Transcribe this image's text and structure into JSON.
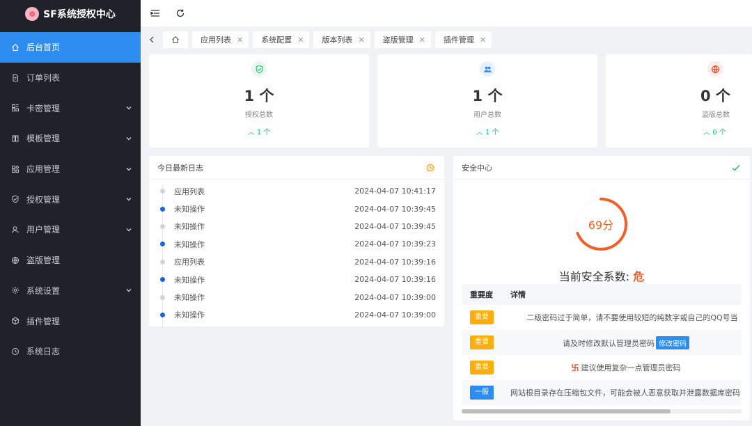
{
  "app": {
    "title": "SF系统授权中心",
    "logo_glyph": "❁"
  },
  "sidebar": {
    "items": [
      {
        "label": "后台首页",
        "icon": "home-icon",
        "active": true,
        "chevron": false
      },
      {
        "label": "订单列表",
        "icon": "document-icon",
        "active": false,
        "chevron": false
      },
      {
        "label": "卡密管理",
        "icon": "grid-icon",
        "active": false,
        "chevron": true
      },
      {
        "label": "模板管理",
        "icon": "book-icon",
        "active": false,
        "chevron": true
      },
      {
        "label": "应用管理",
        "icon": "apps-icon",
        "active": false,
        "chevron": true
      },
      {
        "label": "授权管理",
        "icon": "shield-icon",
        "active": false,
        "chevron": true
      },
      {
        "label": "用户管理",
        "icon": "user-icon",
        "active": false,
        "chevron": true
      },
      {
        "label": "盗版管理",
        "icon": "globe-icon",
        "active": false,
        "chevron": false
      },
      {
        "label": "系统设置",
        "icon": "gear-icon",
        "active": false,
        "chevron": true
      },
      {
        "label": "插件管理",
        "icon": "cube-icon",
        "active": false,
        "chevron": false
      },
      {
        "label": "系统日志",
        "icon": "clock-icon",
        "active": false,
        "chevron": false
      }
    ]
  },
  "tabs": [
    {
      "label": "应用列表"
    },
    {
      "label": "系统配置"
    },
    {
      "label": "版本列表"
    },
    {
      "label": "盗版管理"
    },
    {
      "label": "插件管理"
    }
  ],
  "stats": [
    {
      "value": "1 个",
      "label": "授权总数",
      "delta": "1 个",
      "icon": "shield-check-icon",
      "color": "#19be6b",
      "bg": "#e8f8ef"
    },
    {
      "value": "1 个",
      "label": "用户总数",
      "delta": "1 个",
      "icon": "users-icon",
      "color": "#2d8cf0",
      "bg": "#e6f1fd"
    },
    {
      "value": "0 个",
      "label": "盗版总数",
      "delta": "0 个",
      "icon": "globe-icon",
      "color": "#ed4014",
      "bg": "#fdecec"
    }
  ],
  "log": {
    "title": "今日最新日志",
    "rows": [
      {
        "action": "应用列表",
        "time": "2024-04-07 10:41:17",
        "dot": "gray"
      },
      {
        "action": "未知操作",
        "time": "2024-04-07 10:39:45",
        "dot": "blue"
      },
      {
        "action": "未知操作",
        "time": "2024-04-07 10:39:45",
        "dot": "gray"
      },
      {
        "action": "未知操作",
        "time": "2024-04-07 10:39:23",
        "dot": "blue"
      },
      {
        "action": "应用列表",
        "time": "2024-04-07 10:39:16",
        "dot": "gray"
      },
      {
        "action": "未知操作",
        "time": "2024-04-07 10:39:16",
        "dot": "blue"
      },
      {
        "action": "未知操作",
        "time": "2024-04-07 10:39:00",
        "dot": "gray"
      },
      {
        "action": "未知操作",
        "time": "2024-04-07 10:39:00",
        "dot": "blue"
      }
    ]
  },
  "security": {
    "title": "安全中心",
    "score": 69,
    "score_text": "69分",
    "rating_label": "当前安全系数:",
    "rating_value": "危",
    "columns": {
      "level": "重要度",
      "detail": "详情"
    },
    "rows": [
      {
        "level": "重要",
        "level_color": "orange",
        "detail": "二级密码过于简单，请不要使用较短的纯数字或自己的QQ号当",
        "action": ""
      },
      {
        "level": "重要",
        "level_color": "orange",
        "detail": "请及时修改默认管理员密码",
        "action": "修改密码"
      },
      {
        "level": "重要",
        "level_color": "orange",
        "detail": "建议使用复杂一点管理员密码",
        "action": "",
        "prefix": "卐"
      },
      {
        "level": "一般",
        "level_color": "blue",
        "detail": "网站根目录存在压缩包文件，可能会被人恶意获取并泄露数据库密码",
        "action": ""
      }
    ]
  }
}
